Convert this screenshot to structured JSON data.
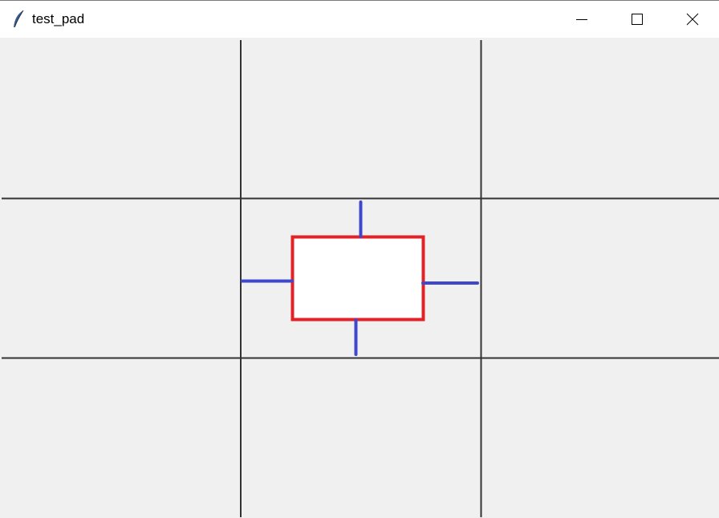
{
  "window": {
    "title": "test_pad",
    "app_icon": "feather-icon",
    "controls": {
      "minimize_icon": "minimize-icon",
      "maximize_icon": "maximize-icon",
      "close_icon": "close-icon"
    }
  },
  "canvas": {
    "background_color": "#f0f0f0",
    "grid_line_color": "#333333",
    "grid": {
      "rows": 3,
      "columns": 3
    },
    "center_box": {
      "fill_color": "#ffffff",
      "border_color": "#e32228"
    },
    "connector_color": "#3f48cc"
  }
}
